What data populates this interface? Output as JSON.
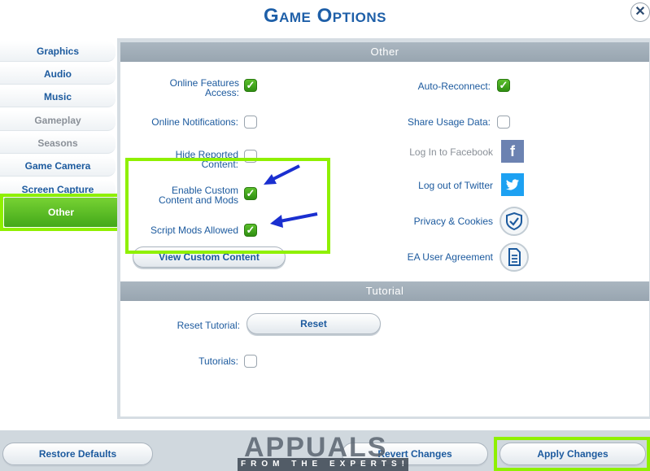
{
  "window": {
    "title": "Game Options",
    "close_glyph": "✕"
  },
  "sidebar": {
    "items": [
      {
        "label": "Graphics",
        "state": "normal"
      },
      {
        "label": "Audio",
        "state": "normal"
      },
      {
        "label": "Music",
        "state": "normal"
      },
      {
        "label": "Gameplay",
        "state": "disabled"
      },
      {
        "label": "Seasons",
        "state": "disabled"
      },
      {
        "label": "Game Camera",
        "state": "normal"
      },
      {
        "label": "Screen Capture",
        "state": "normal"
      },
      {
        "label": "Other",
        "state": "active"
      }
    ]
  },
  "other_section": {
    "header": "Other",
    "left": {
      "online_features_label": "Online Features Access:",
      "online_features_checked": true,
      "online_notifications_label": "Online Notifications:",
      "online_notifications_checked": false,
      "hide_reported_label": "Hide Reported Content:",
      "hide_reported_checked": false,
      "custom_content_label": "Enable Custom Content and Mods",
      "custom_content_checked": true,
      "script_mods_label": "Script Mods Allowed",
      "script_mods_checked": true,
      "view_custom_button": "View Custom Content"
    },
    "right": {
      "auto_reconnect_label": "Auto-Reconnect:",
      "auto_reconnect_checked": true,
      "share_usage_label": "Share Usage Data:",
      "share_usage_checked": false,
      "facebook_label": "Log In to Facebook",
      "facebook_icon": "facebook-icon",
      "facebook_glyph": "f",
      "twitter_label": "Log out of Twitter",
      "twitter_icon": "twitter-icon",
      "privacy_label": "Privacy & Cookies",
      "privacy_icon": "shield-check-icon",
      "ea_label": "EA User Agreement",
      "ea_icon": "document-icon"
    }
  },
  "tutorial_section": {
    "header": "Tutorial",
    "reset_label": "Reset Tutorial:",
    "reset_button": "Reset",
    "tutorials_label": "Tutorials:",
    "tutorials_checked": false
  },
  "footer": {
    "restore_defaults": "Restore Defaults",
    "revert_changes": "Revert Changes",
    "apply_changes": "Apply Changes"
  },
  "watermark": {
    "brand": "APPUALS",
    "tagline": "FROM THE EXPERTS!"
  },
  "colors": {
    "accent": "#1c5a9e",
    "highlight": "#8ff000",
    "active_tab": "#4caf20",
    "arrow": "#1a2fd0"
  }
}
